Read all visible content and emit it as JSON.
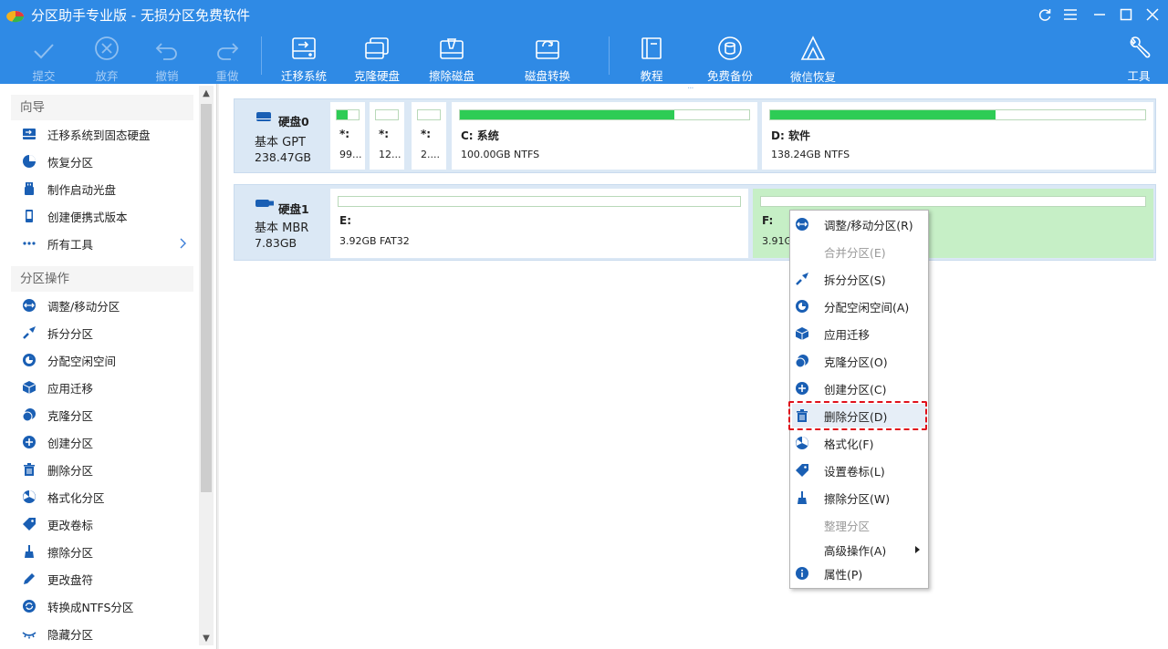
{
  "window": {
    "title": "分区助手专业版 - 无损分区免费软件",
    "colors": {
      "accent": "#2f8ae5",
      "partition_fill": "#2ecc55",
      "selected_partition": "#c6efc6",
      "disk_panel": "#dbe8f5",
      "highlight_box": "#e0111b"
    }
  },
  "toolbar": {
    "submit": "提交",
    "discard": "放弃",
    "undo": "撤销",
    "redo": "重做",
    "migrate": "迁移系统",
    "clone": "克隆硬盘",
    "wipe": "擦除磁盘",
    "convert": "磁盘转换",
    "tutorial": "教程",
    "backup": "免费备份",
    "wechat": "微信恢复",
    "tools": "工具"
  },
  "sidebar": {
    "wizard_title": "向导",
    "wizard_items": [
      {
        "label": "迁移系统到固态硬盘",
        "icon": "migrate-disk-icon"
      },
      {
        "label": "恢复分区",
        "icon": "pie-recover-icon"
      },
      {
        "label": "制作启动光盘",
        "icon": "usb-icon"
      },
      {
        "label": "创建便携式版本",
        "icon": "portable-device-icon"
      },
      {
        "label": "所有工具",
        "icon": "dots-icon"
      }
    ],
    "ops_title": "分区操作",
    "ops_items": [
      {
        "label": "调整/移动分区",
        "icon": "resize-icon"
      },
      {
        "label": "拆分分区",
        "icon": "split-icon"
      },
      {
        "label": "分配空闲空间",
        "icon": "allocate-icon"
      },
      {
        "label": "应用迁移",
        "icon": "box-icon"
      },
      {
        "label": "克隆分区",
        "icon": "clone-icon"
      },
      {
        "label": "创建分区",
        "icon": "create-icon"
      },
      {
        "label": "删除分区",
        "icon": "trash-icon"
      },
      {
        "label": "格式化分区",
        "icon": "format-icon"
      },
      {
        "label": "更改卷标",
        "icon": "tag-icon"
      },
      {
        "label": "擦除分区",
        "icon": "broom-icon"
      },
      {
        "label": "更改盘符",
        "icon": "pen-icon"
      },
      {
        "label": "转换成NTFS分区",
        "icon": "convert-icon"
      },
      {
        "label": "隐藏分区",
        "icon": "eye-hidden-icon"
      }
    ]
  },
  "disks": [
    {
      "name": "硬盘0",
      "type": "基本 GPT",
      "size": "238.47GB",
      "partitions": [
        {
          "label": "*:",
          "desc": "99...",
          "used": 0.5
        },
        {
          "label": "*:",
          "desc": "12...",
          "used": 0
        },
        {
          "label": "*:",
          "desc": "2....",
          "used": 0
        },
        {
          "label": "C: 系统",
          "desc": "100.00GB NTFS",
          "used": 0.74
        },
        {
          "label": "D: 软件",
          "desc": "138.24GB NTFS",
          "used": 0.6
        }
      ]
    },
    {
      "name": "硬盘1",
      "type": "基本 MBR",
      "size": "7.83GB",
      "partitions": [
        {
          "label": "E:",
          "desc": "3.92GB FAT32",
          "used": 0
        },
        {
          "label": "F:",
          "desc": "3.91GB",
          "used": 0
        }
      ]
    }
  ],
  "context_menu": [
    {
      "label": "调整/移动分区(R)",
      "enabled": true,
      "icon": "resize-icon"
    },
    {
      "label": "合并分区(E)",
      "enabled": false,
      "icon": ""
    },
    {
      "label": "拆分分区(S)",
      "enabled": true,
      "icon": "split-icon"
    },
    {
      "label": "分配空闲空间(A)",
      "enabled": true,
      "icon": "allocate-icon"
    },
    {
      "label": "应用迁移",
      "enabled": true,
      "icon": "box-icon"
    },
    {
      "label": "克隆分区(O)",
      "enabled": true,
      "icon": "clone-icon"
    },
    {
      "label": "创建分区(C)",
      "enabled": true,
      "icon": "create-icon"
    },
    {
      "label": "删除分区(D)",
      "enabled": true,
      "highlighted": true,
      "icon": "trash-icon"
    },
    {
      "label": "格式化(F)",
      "enabled": true,
      "icon": "format-icon"
    },
    {
      "label": "设置卷标(L)",
      "enabled": true,
      "icon": "tag-icon"
    },
    {
      "label": "擦除分区(W)",
      "enabled": true,
      "icon": "broom-icon"
    },
    {
      "label": "整理分区",
      "enabled": false,
      "icon": ""
    },
    {
      "label": "高级操作(A)",
      "enabled": true,
      "has_submenu": true,
      "icon": ""
    },
    {
      "label": "属性(P)",
      "enabled": true,
      "icon": "info-icon"
    }
  ]
}
